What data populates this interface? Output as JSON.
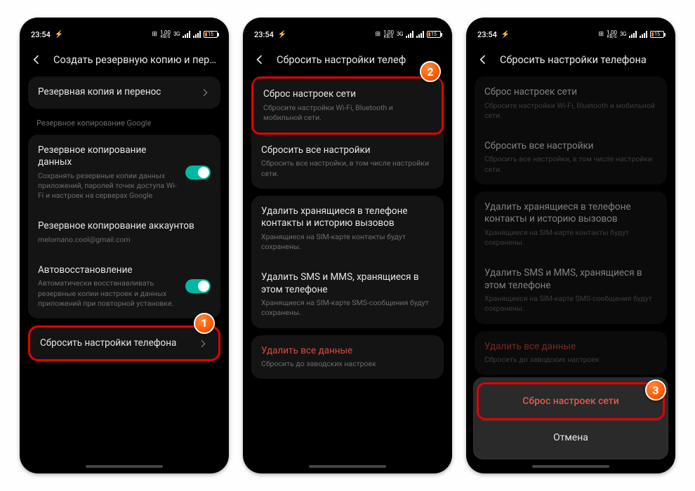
{
  "status": {
    "time": "23:54",
    "speed_num": "1,00",
    "speed_unit": "KB/S",
    "net": "3G",
    "battery": "15"
  },
  "s1": {
    "title": "Создать резервную копию и перезаг..",
    "i1": "Резервная копия и перенос",
    "sec": "Резервное копирование Google",
    "i2t": "Резервное копирование данных",
    "i2s": "Сохранять резервные копии данных приложений, паролей точек доступа Wi-Fi и настроек на серверах Google",
    "i3t": "Резервное копирование аккаунтов",
    "i3s": "melomano.cool@gmail.com",
    "i4t": "Автовосстановление",
    "i4s": "Автоматически восстанавливать резервные копии настроек и данных приложений при повторной установке.",
    "i5": "Сбросить настройки телефона"
  },
  "s2": {
    "title": "Сбросить настройки телеф",
    "r1t": "Сброс настроек сети",
    "r1s": "Сбросите настройки Wi-Fi, Bluetooth и мобильной сети.",
    "r2t": "Сбросить все настройки",
    "r2s": "Сбросить все настройки, в том числе настройки сети.",
    "r3t": "Удалить хранящиеся в телефоне контакты и историю вызовов",
    "r3s": "Хранящиеся на SIM-карте контакты будут сохранены.",
    "r4t": "Удалить SMS и MMS, хранящиеся в этом телефоне",
    "r4s": "Хранящиеся на SIM-карте SMS-сообщения будут сохранены.",
    "r5t": "Удалить все данные",
    "r5s": "Сбросить до заводских настроек"
  },
  "s3": {
    "title": "Сбросить настройки телефона",
    "sheet_primary": "Сброс настроек сети",
    "sheet_cancel": "Отмена"
  },
  "callouts": {
    "one": "1",
    "two": "2",
    "three": "3"
  }
}
